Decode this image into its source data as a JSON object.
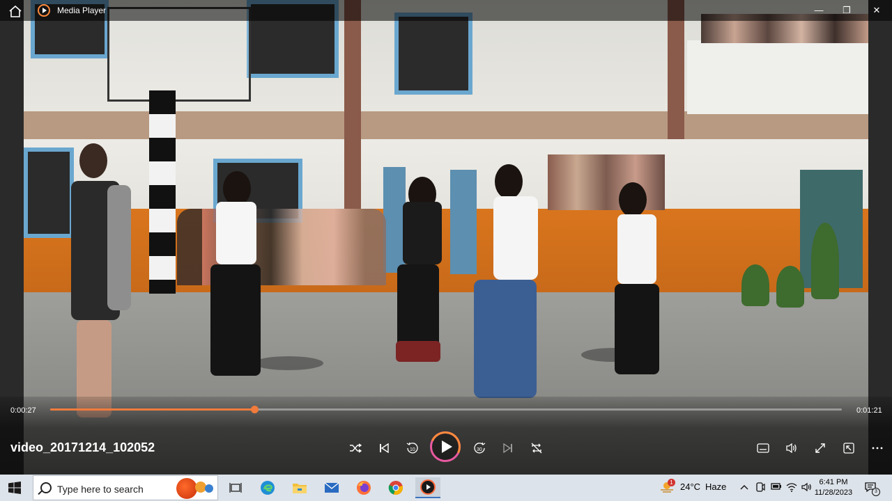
{
  "window": {
    "app_title": "Media Player",
    "buttons": {
      "minimize": "—",
      "maximize": "❐",
      "close": "✕"
    }
  },
  "player": {
    "elapsed": "0:00:27",
    "duration": "0:01:21",
    "progress_fraction": 0.2577,
    "video_title": "video_20171214_102052",
    "accent_color": "#f07b3c",
    "controls": [
      {
        "name": "shuffle",
        "glyph": "⤨"
      },
      {
        "name": "previous",
        "glyph": "⏮"
      },
      {
        "name": "skip-back-10",
        "glyph": "↺",
        "label": "10"
      },
      {
        "name": "play",
        "glyph": "▶"
      },
      {
        "name": "skip-forward-30",
        "glyph": "↻",
        "label": "30"
      },
      {
        "name": "next",
        "glyph": "⏭"
      },
      {
        "name": "repeat",
        "glyph": "🔁"
      }
    ],
    "right_controls": [
      "captions",
      "volume",
      "fullscreen",
      "mini-player",
      "more"
    ]
  },
  "taskbar": {
    "search_placeholder": "Type here to search",
    "weather_temp": "24°C",
    "weather_desc": "Haze",
    "weather_badge": "1",
    "time": "6:41 PM",
    "date": "11/28/2023",
    "notification_count": "3"
  }
}
